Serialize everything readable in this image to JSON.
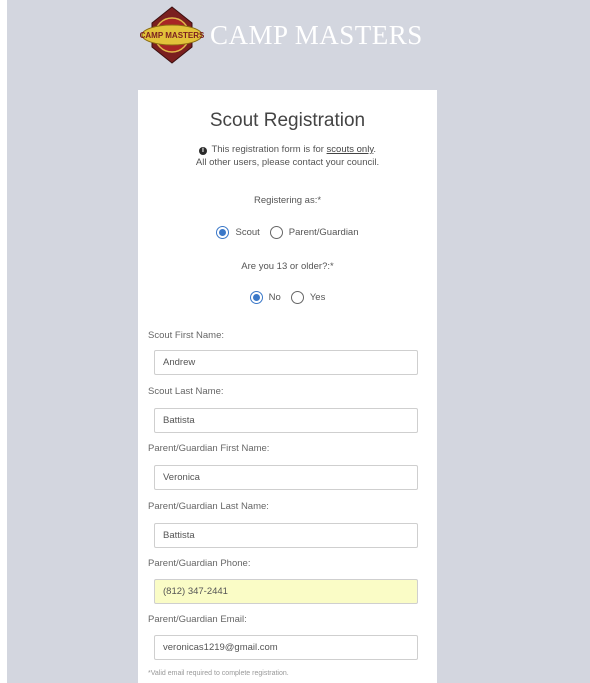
{
  "brand": {
    "emblem_text": "CAMP MASTERS",
    "name": "CAMP MASTERS",
    "colors": {
      "background": "#d3d6df",
      "accent": "#3b78c8",
      "highlight": "#fafcc6"
    }
  },
  "form": {
    "title": "Scout Registration",
    "notice_prefix": "This registration form is for",
    "notice_link": "scouts only",
    "notice_period": ".",
    "notice_line2": "All other users, please contact your council.",
    "registering_label": "Registering as:*",
    "registering_options": [
      "Scout",
      "Parent/Guardian"
    ],
    "registering_selected": "Scout",
    "age_label": "Are you 13 or older?:*",
    "age_options": [
      "No",
      "Yes"
    ],
    "age_selected": "No",
    "fields": {
      "scout_first": {
        "label": "Scout First Name:",
        "value": "Andrew"
      },
      "scout_last": {
        "label": "Scout Last Name:",
        "value": "Battista"
      },
      "parent_first": {
        "label": "Parent/Guardian First Name:",
        "value": "Veronica"
      },
      "parent_last": {
        "label": "Parent/Guardian Last Name:",
        "value": "Battista"
      },
      "parent_phone": {
        "label": "Parent/Guardian Phone:",
        "value": "(812) 347-2441"
      },
      "parent_email": {
        "label": "Parent/Guardian Email:",
        "value": "veronicas1219@gmail.com"
      }
    },
    "email_note": "*Valid email required to complete registration."
  }
}
